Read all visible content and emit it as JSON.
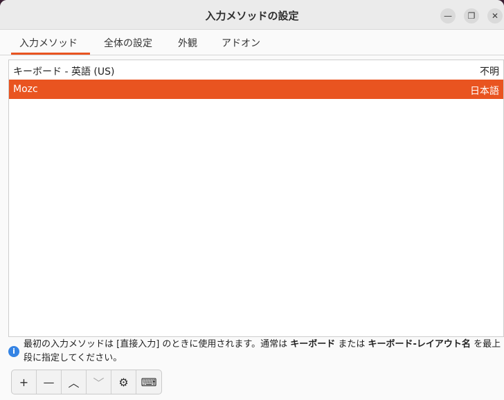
{
  "window": {
    "title": "入力メソッドの設定",
    "controls": {
      "minimize": "—",
      "maximize": "❐",
      "close": "✕"
    }
  },
  "tabs": [
    {
      "label": "入力メソッド",
      "active": true
    },
    {
      "label": "全体の設定",
      "active": false
    },
    {
      "label": "外観",
      "active": false
    },
    {
      "label": "アドオン",
      "active": false
    }
  ],
  "input_methods": [
    {
      "name": "キーボード - 英語 (US)",
      "language": "不明",
      "selected": false
    },
    {
      "name": "Mozc",
      "language": "日本語",
      "selected": true
    }
  ],
  "info": {
    "icon": "info-icon",
    "text_parts": [
      {
        "t": "最初の入力メソッドは [直接入力] のときに使用されます。通常は ",
        "bold": false
      },
      {
        "t": "キーボード",
        "bold": true
      },
      {
        "t": " または ",
        "bold": false
      },
      {
        "t": "キーボード-レイアウト名",
        "bold": true
      },
      {
        "t": " を最上段に指定してください。",
        "bold": false
      }
    ]
  },
  "toolbar": [
    {
      "name": "add-icon",
      "glyph": "+",
      "enabled": true
    },
    {
      "name": "remove-icon",
      "glyph": "—",
      "enabled": true
    },
    {
      "name": "move-up-icon",
      "glyph": "︿",
      "enabled": true
    },
    {
      "name": "move-down-icon",
      "glyph": "﹀",
      "enabled": false
    },
    {
      "name": "configure-icon",
      "glyph": "⚙",
      "enabled": true
    },
    {
      "name": "keyboard-layout-icon",
      "glyph": "⌨",
      "enabled": true
    }
  ],
  "colors": {
    "accent": "#e95420",
    "info": "#3584e4"
  }
}
